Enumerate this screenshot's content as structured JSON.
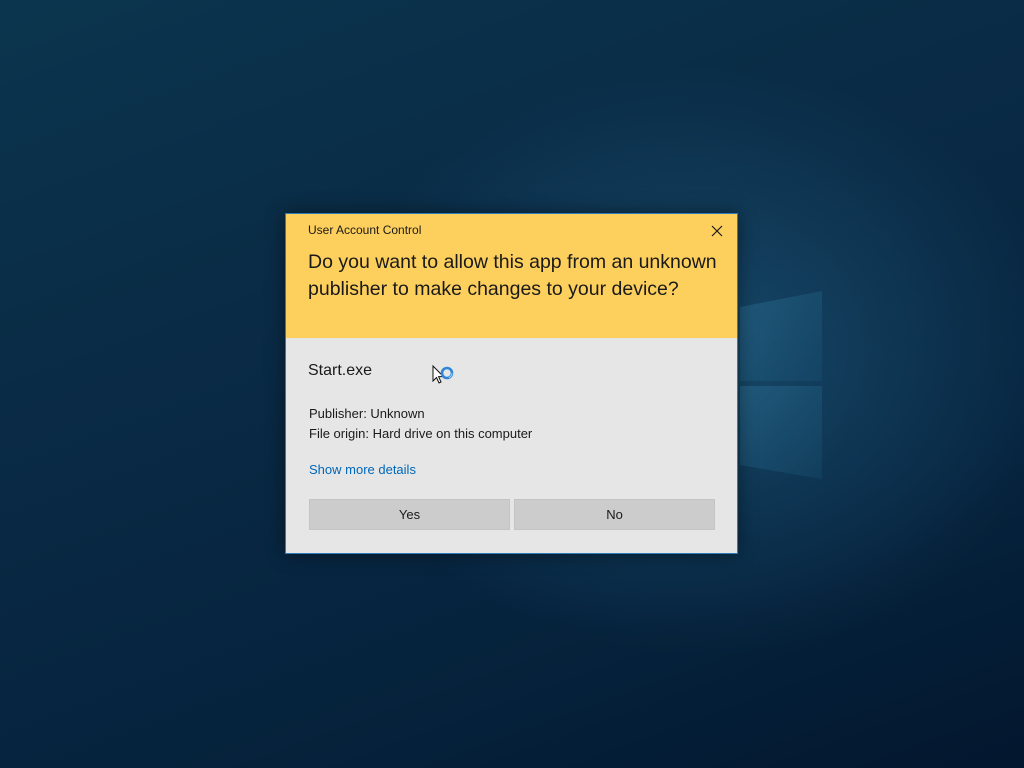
{
  "dialog": {
    "title": "User Account Control",
    "question": "Do you want to allow this app from an unknown publisher to make changes to your device?",
    "app_name": "Start.exe",
    "publisher": "Publisher: Unknown",
    "file_origin": "File origin: Hard drive on this computer",
    "details_link": "Show more details",
    "yes_label": "Yes",
    "no_label": "No"
  },
  "colors": {
    "header": "#fdcf5c",
    "body": "#e6e6e6",
    "link": "#0067b8",
    "border": "#2d7bb8"
  },
  "icons": {
    "close": "close-icon",
    "cursor": "busy-cursor-icon",
    "background": "windows-logo-icon"
  }
}
